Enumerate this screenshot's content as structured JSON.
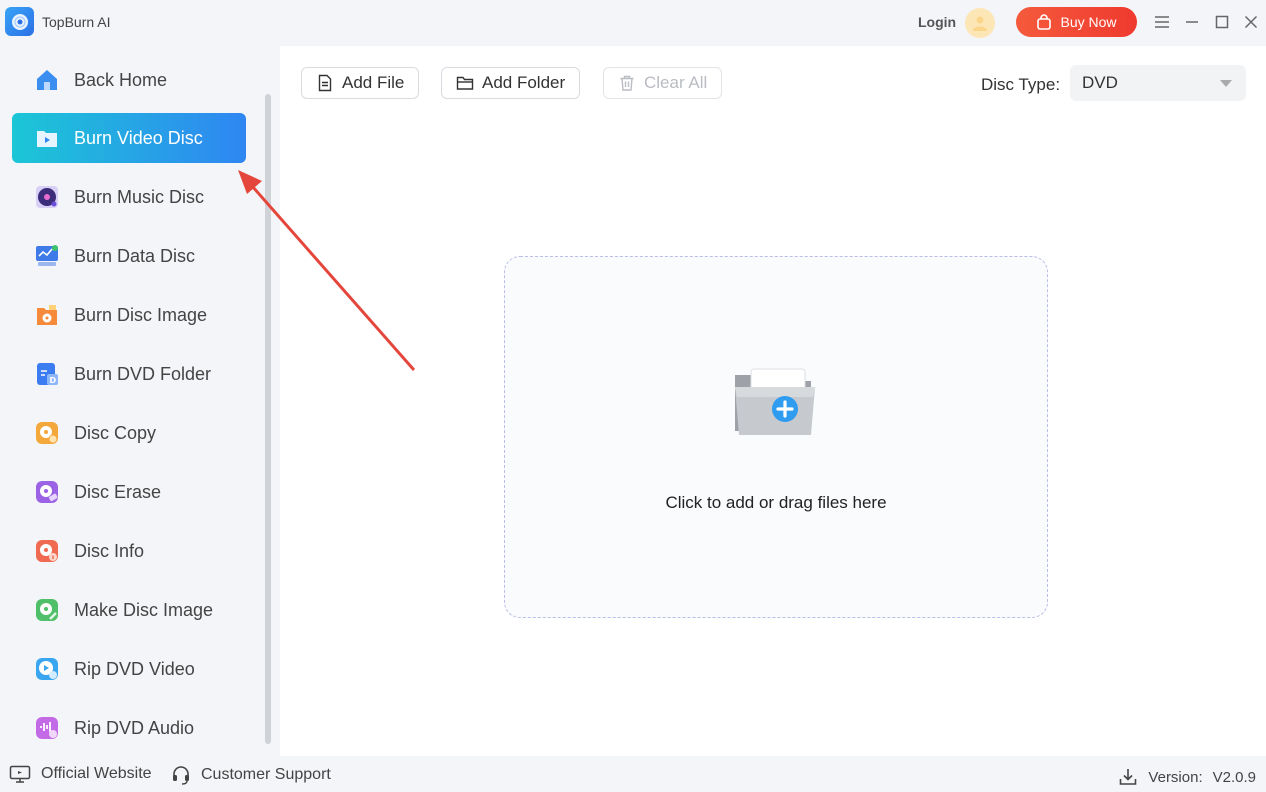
{
  "app": {
    "title": "TopBurn AI"
  },
  "header": {
    "login_label": "Login",
    "buy_label": "Buy Now"
  },
  "sidebar": {
    "items": [
      {
        "label": "Back Home",
        "icon": "home-icon",
        "color": "#3a8ef0"
      },
      {
        "label": "Burn Video Disc",
        "icon": "video-disc-icon",
        "color": "#ffffff",
        "active": true
      },
      {
        "label": "Burn Music Disc",
        "icon": "music-disc-icon",
        "color": "#6b4fd8"
      },
      {
        "label": "Burn Data Disc",
        "icon": "data-disc-icon",
        "color": "#3f7be8"
      },
      {
        "label": "Burn Disc Image",
        "icon": "disc-image-icon",
        "color": "#f58a3a"
      },
      {
        "label": "Burn DVD Folder",
        "icon": "dvd-folder-icon",
        "color": "#3b7df0"
      },
      {
        "label": "Disc Copy",
        "icon": "disc-copy-icon",
        "color": "#f4a73a"
      },
      {
        "label": "Disc Erase",
        "icon": "disc-erase-icon",
        "color": "#9b62e6"
      },
      {
        "label": "Disc Info",
        "icon": "disc-info-icon",
        "color": "#f06a52"
      },
      {
        "label": "Make Disc Image",
        "icon": "make-disc-image-icon",
        "color": "#4fbf6a"
      },
      {
        "label": "Rip DVD Video",
        "icon": "rip-video-icon",
        "color": "#3aa6f0"
      },
      {
        "label": "Rip DVD Audio",
        "icon": "rip-audio-icon",
        "color": "#c36ae6"
      }
    ]
  },
  "toolbar": {
    "add_file": "Add File",
    "add_folder": "Add Folder",
    "clear_all": "Clear All",
    "disc_type_label": "Disc Type:",
    "disc_type_value": "DVD"
  },
  "dropzone": {
    "text": "Click to add or drag files here"
  },
  "footer": {
    "official_website": "Official Website",
    "customer_support": "Customer Support",
    "version_label": "Version:",
    "version_value": "V2.0.9"
  }
}
